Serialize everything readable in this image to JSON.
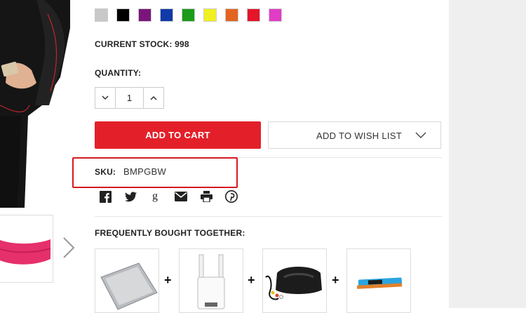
{
  "product": {
    "stock_text": "CURRENT STOCK: 998",
    "quantity_label": "QUANTITY:",
    "quantity_value": "1",
    "sku_label": "SKU:",
    "sku_value": "BMPGBW"
  },
  "swatches": [
    {
      "name": "silver",
      "color": "#c8c8c8"
    },
    {
      "name": "black",
      "color": "#000000"
    },
    {
      "name": "purple",
      "color": "#7a157c"
    },
    {
      "name": "blue",
      "color": "#0f3aa8"
    },
    {
      "name": "green",
      "color": "#1a9b1a"
    },
    {
      "name": "yellow",
      "color": "#f0f020"
    },
    {
      "name": "orange",
      "color": "#e3641f"
    },
    {
      "name": "red",
      "color": "#e5152a"
    },
    {
      "name": "pink",
      "color": "#e13cc6"
    }
  ],
  "actions": {
    "add_to_cart": "ADD TO CART",
    "add_to_wishlist": "ADD TO WISH LIST"
  },
  "share": [
    "facebook-icon",
    "twitter-icon",
    "google-plus-icon",
    "email-icon",
    "print-icon",
    "pinterest-icon"
  ],
  "fbt": {
    "label": "FREQUENTLY BOUGHT TOGETHER:",
    "items": [
      "laptop screen panel",
      "wifi range extender",
      "car dvr recorder",
      "toner cartridge"
    ]
  },
  "colors": {
    "accent": "#e3202a",
    "highlight_box": "#d6191f"
  }
}
